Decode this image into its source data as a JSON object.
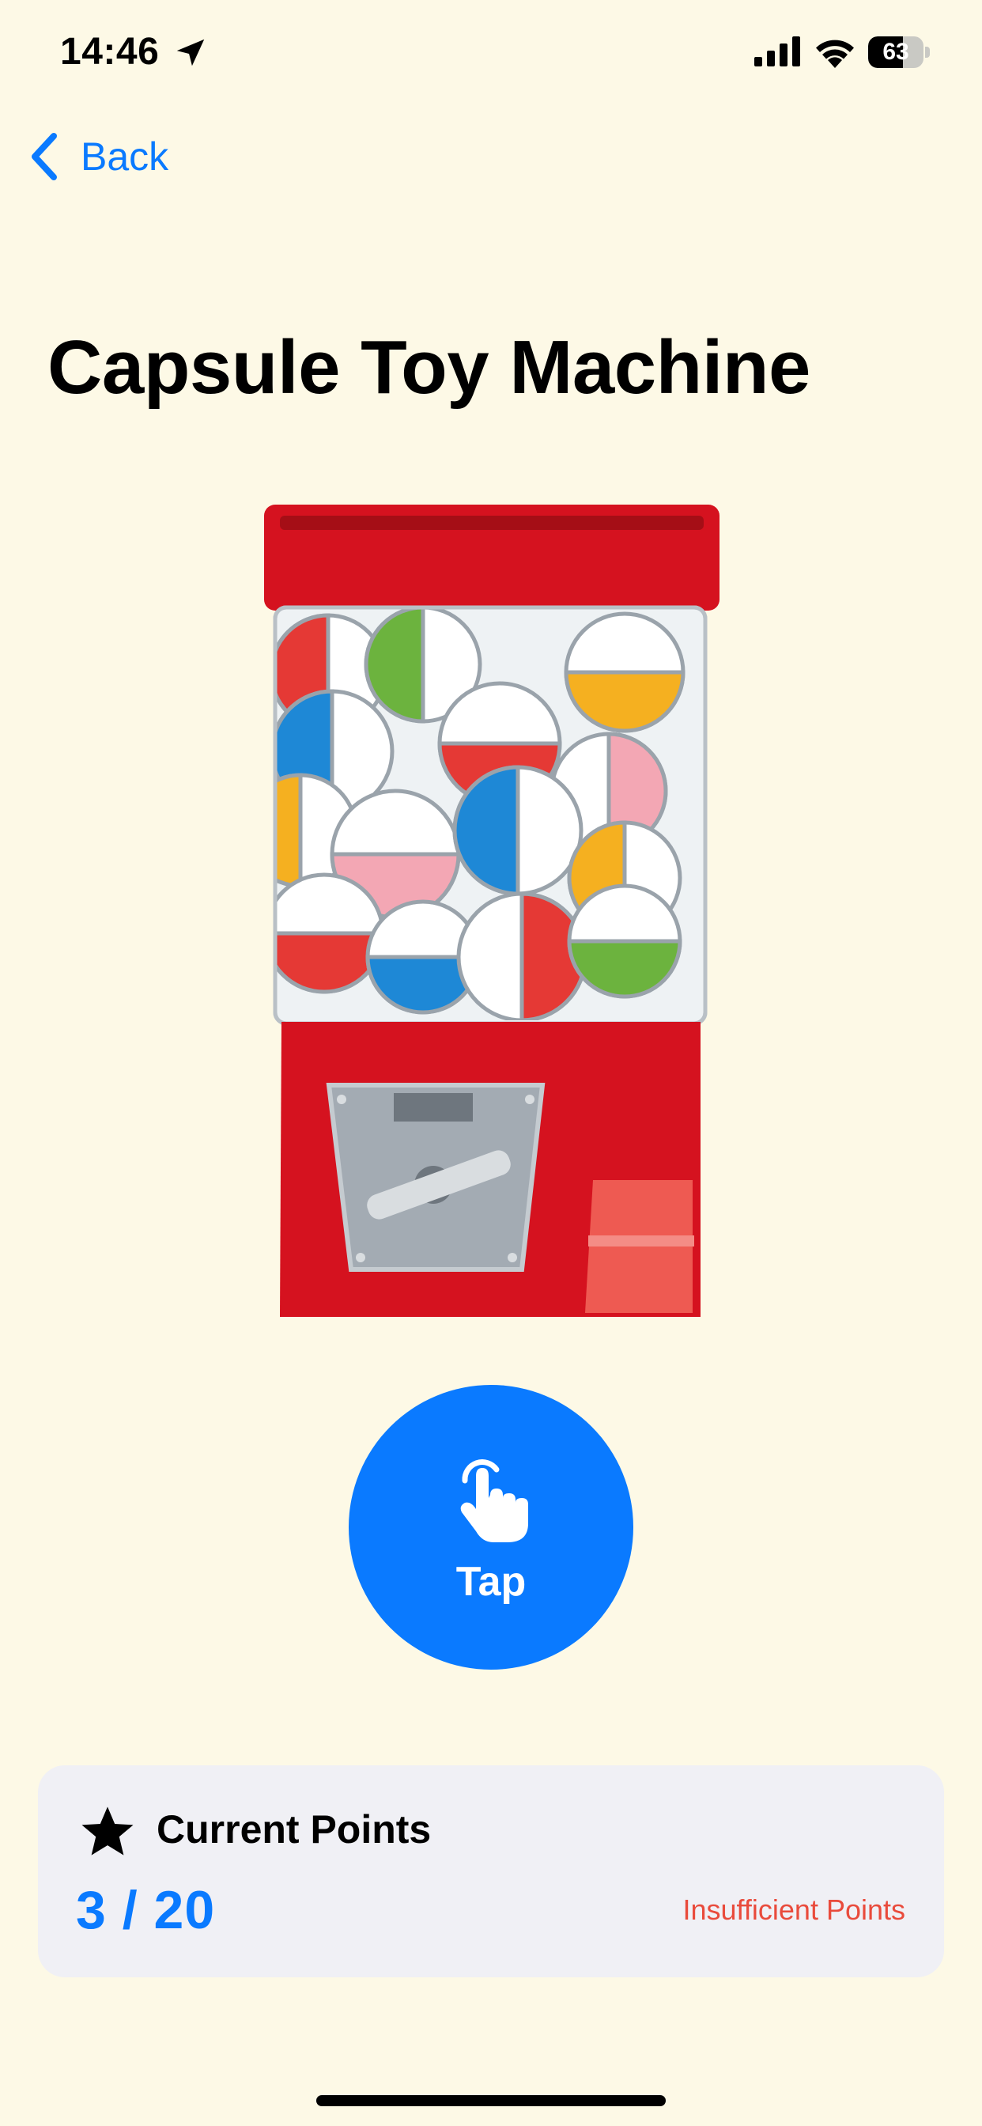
{
  "status_bar": {
    "time": "14:46",
    "battery_level": "63",
    "battery_fraction": 0.63,
    "icons": [
      "location-arrow-icon",
      "cellular-signal-icon",
      "wifi-icon",
      "battery-icon"
    ]
  },
  "nav": {
    "back_label": "Back",
    "back_icon": "chevron-left-icon"
  },
  "page": {
    "title": "Capsule Toy Machine",
    "illustration": "capsule-toy-machine-illustration"
  },
  "tap_button": {
    "label": "Tap",
    "icon": "hand-tap-icon"
  },
  "points_card": {
    "icon": "star-icon",
    "label": "Current Points",
    "value": "3 / 20",
    "current": 3,
    "required": 20,
    "status": "Insufficient Points"
  },
  "colors": {
    "background": "#FDF9E6",
    "accent": "#0A7AFF",
    "warning": "#E94B3C",
    "card": "#F0F0F5",
    "machine_red": "#D5121F"
  }
}
